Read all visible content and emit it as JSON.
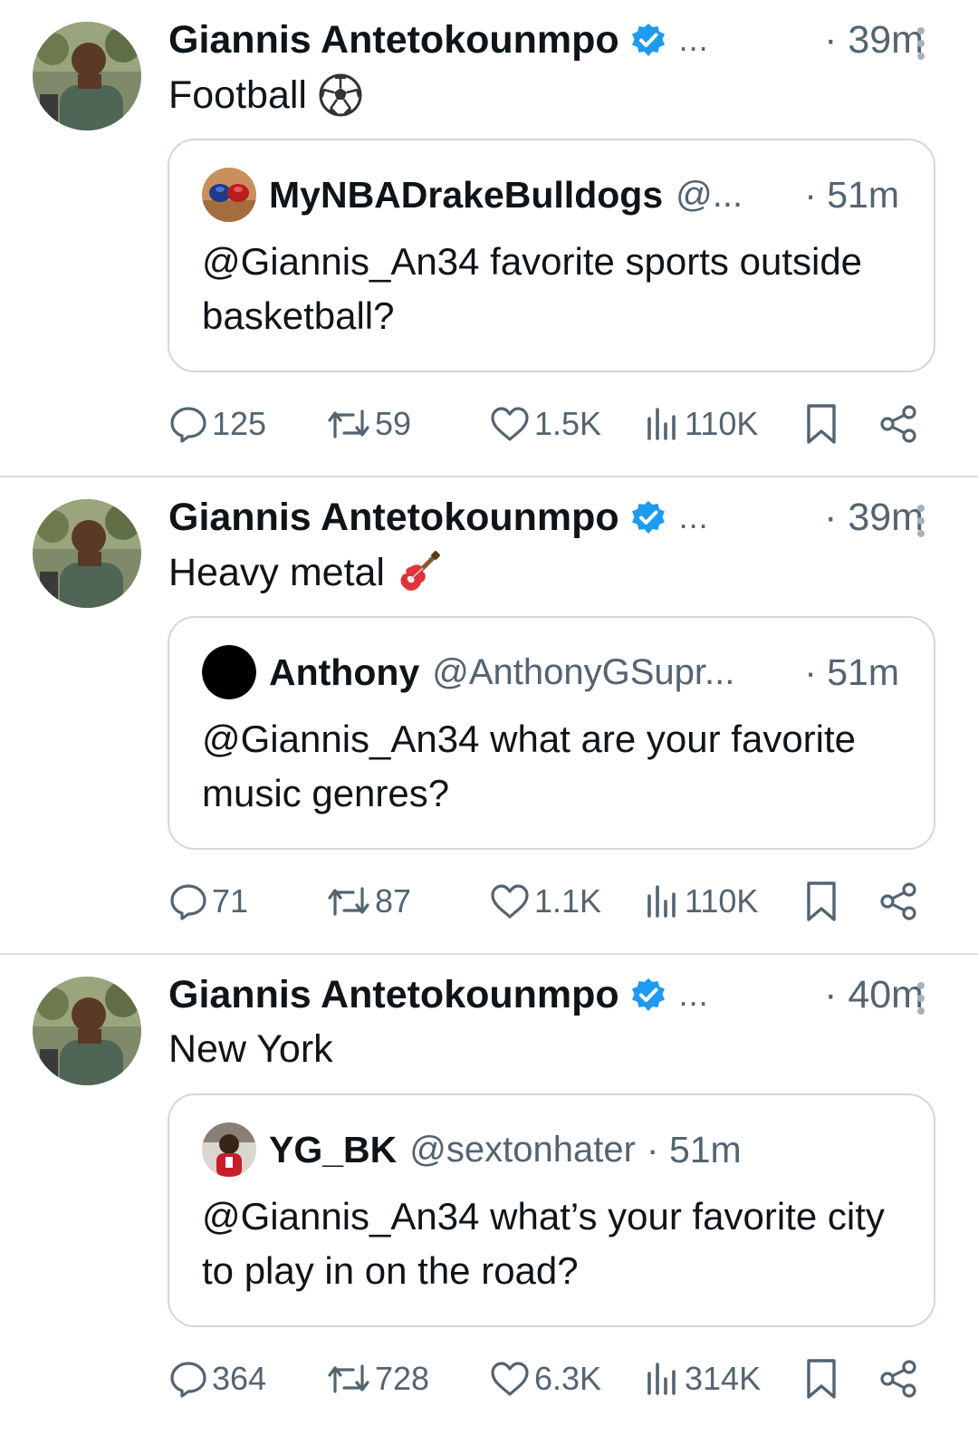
{
  "tweets": [
    {
      "author": "Giannis Antetokounmpo",
      "ellipsis": "...",
      "time": "· 39m",
      "text": "Football",
      "emoji_icon": "soccer-ball-icon",
      "quote": {
        "name": "MyNBADrakeBulldogs",
        "handle": "@...",
        "time": "· 51m",
        "text": "@Giannis_An34 favorite sports outside basketball?",
        "avatar_icon": "boxing-gloves-avatar"
      },
      "replies": "125",
      "reposts": "59",
      "likes": "1.5K",
      "views": "110K"
    },
    {
      "author": "Giannis Antetokounmpo",
      "ellipsis": "...",
      "time": "· 39m",
      "text": "Heavy metal",
      "emoji_icon": "guitar-icon",
      "quote": {
        "name": "Anthony",
        "handle": "@AnthonyGSupr...",
        "time": "· 51m",
        "text": "@Giannis_An34 what are your favorite music genres?",
        "avatar_icon": "black-circle-avatar"
      },
      "replies": "71",
      "reposts": "87",
      "likes": "1.1K",
      "views": "110K"
    },
    {
      "author": "Giannis Antetokounmpo",
      "ellipsis": "...",
      "time": "· 40m",
      "text": "New York",
      "emoji_icon": "",
      "quote": {
        "name": "YG_BK",
        "handle": "@sextonhater",
        "time": "· 51m",
        "text": "@Giannis_An34 what’s your favorite city to play in on the road?",
        "avatar_icon": "player-photo-avatar"
      },
      "replies": "364",
      "reposts": "728",
      "likes": "6.3K",
      "views": "314K"
    }
  ],
  "colors": {
    "text": "#0f1419",
    "secondary": "#536471",
    "verified": "#1d9bf0",
    "border": "#cfd9de",
    "divider": "#d9dde1"
  },
  "icons": [
    "reply-icon",
    "repost-icon",
    "like-icon",
    "views-icon",
    "bookmark-icon",
    "share-icon",
    "more-icon",
    "verified-badge-icon"
  ]
}
